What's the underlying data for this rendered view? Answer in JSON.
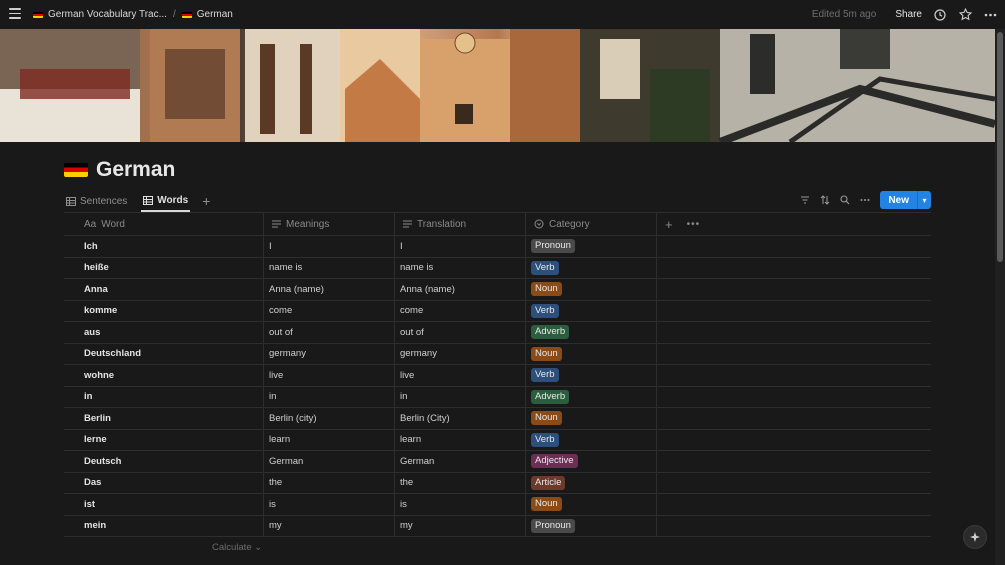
{
  "topbar": {
    "breadcrumbs": [
      {
        "label": "German Vocabulary Trac..."
      },
      {
        "label": "German"
      }
    ],
    "separator": "/",
    "edited": "Edited 5m ago",
    "share": "Share"
  },
  "page": {
    "title": "German"
  },
  "views": {
    "tabs": [
      {
        "label": "Sentences",
        "icon": "table-icon"
      },
      {
        "label": "Words",
        "icon": "table-icon",
        "active": true
      }
    ],
    "add": "+"
  },
  "toolbar": {
    "new_label": "New"
  },
  "table": {
    "columns": [
      {
        "label": "Word",
        "icon": "Aa"
      },
      {
        "label": "Meanings",
        "icon": "text-icon"
      },
      {
        "label": "Translation",
        "icon": "text-icon"
      },
      {
        "label": "Category",
        "icon": "select-icon"
      }
    ],
    "rows": [
      {
        "word": "Ich",
        "meanings": "I",
        "translation": "I",
        "category": "Pronoun"
      },
      {
        "word": "heiße",
        "meanings": "name is",
        "translation": "name is",
        "category": "Verb"
      },
      {
        "word": "Anna",
        "meanings": "Anna (name)",
        "translation": "Anna (name)",
        "category": "Noun"
      },
      {
        "word": "komme",
        "meanings": "come",
        "translation": "come",
        "category": "Verb"
      },
      {
        "word": "aus",
        "meanings": "out of",
        "translation": "out of",
        "category": "Adverb"
      },
      {
        "word": "Deutschland",
        "meanings": "germany",
        "translation": "germany",
        "category": "Noun"
      },
      {
        "word": "wohne",
        "meanings": "live",
        "translation": "live",
        "category": "Verb"
      },
      {
        "word": "in",
        "meanings": "in",
        "translation": "in",
        "category": "Adverb"
      },
      {
        "word": "Berlin",
        "meanings": "Berlin (city)",
        "translation": "Berlin (City)",
        "category": "Noun"
      },
      {
        "word": "lerne",
        "meanings": "learn",
        "translation": "learn",
        "category": "Verb"
      },
      {
        "word": "Deutsch",
        "meanings": "German",
        "translation": "German",
        "category": "Adjective"
      },
      {
        "word": "Das",
        "meanings": "the",
        "translation": "the",
        "category": "Article"
      },
      {
        "word": "ist",
        "meanings": "is",
        "translation": "is",
        "category": "Noun"
      },
      {
        "word": "mein",
        "meanings": "my",
        "translation": "my",
        "category": "Pronoun"
      }
    ],
    "calculate": "Calculate"
  },
  "category_colors": {
    "Pronoun": "#4a4a4a",
    "Verb": "#2c4f7c",
    "Noun": "#8a4b17",
    "Adverb": "#2b5e3e",
    "Adjective": "#6e2d55",
    "Article": "#6b3a2a"
  },
  "colors": {
    "accent": "#2383e2",
    "background": "#191919"
  }
}
